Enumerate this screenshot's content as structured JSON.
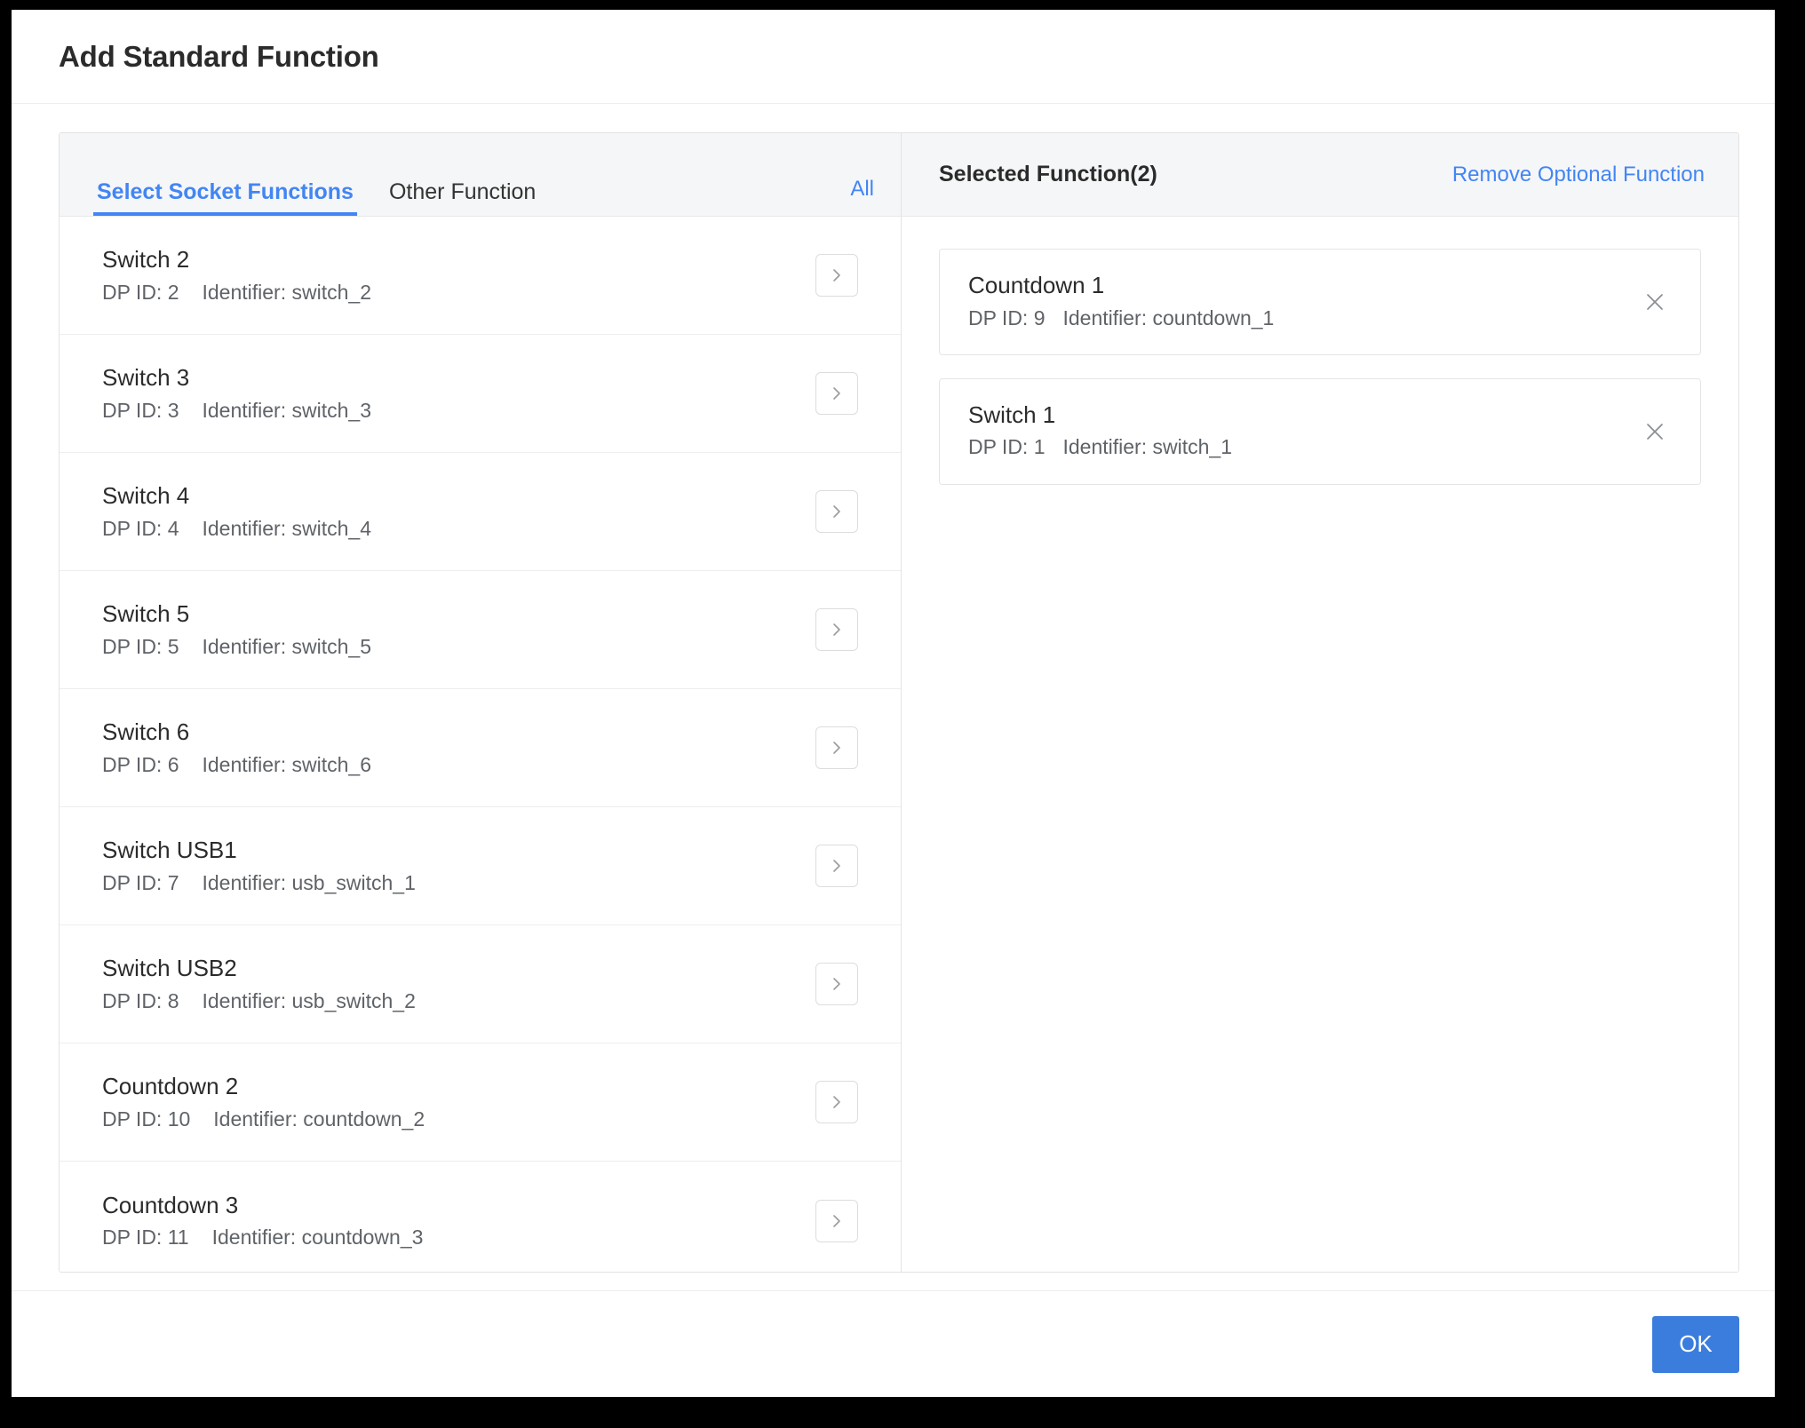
{
  "dialog": {
    "title": "Add Standard Function"
  },
  "left_panel": {
    "tabs": [
      {
        "label": "Select Socket Functions",
        "active": true
      },
      {
        "label": "Other Function",
        "active": false
      }
    ],
    "all_label": "All",
    "chevron_icon": "chevron-right-icon",
    "items": [
      {
        "name": "Switch 2",
        "dp": "DP ID: 2",
        "identifier": "Identifier: switch_2"
      },
      {
        "name": "Switch 3",
        "dp": "DP ID: 3",
        "identifier": "Identifier: switch_3"
      },
      {
        "name": "Switch 4",
        "dp": "DP ID: 4",
        "identifier": "Identifier: switch_4"
      },
      {
        "name": "Switch 5",
        "dp": "DP ID: 5",
        "identifier": "Identifier: switch_5"
      },
      {
        "name": "Switch 6",
        "dp": "DP ID: 6",
        "identifier": "Identifier: switch_6"
      },
      {
        "name": "Switch USB1",
        "dp": "DP ID: 7",
        "identifier": "Identifier: usb_switch_1"
      },
      {
        "name": "Switch USB2",
        "dp": "DP ID: 8",
        "identifier": "Identifier: usb_switch_2"
      },
      {
        "name": "Countdown 2",
        "dp": "DP ID: 10",
        "identifier": "Identifier: countdown_2"
      },
      {
        "name": "Countdown 3",
        "dp": "DP ID: 11",
        "identifier": "Identifier: countdown_3"
      }
    ]
  },
  "right_panel": {
    "title": "Selected Function(2)",
    "remove_label": "Remove Optional Function",
    "close_icon": "close-icon",
    "selected": [
      {
        "name": "Countdown 1",
        "dp": "DP ID: 9",
        "identifier": "Identifier: countdown_1"
      },
      {
        "name": "Switch 1",
        "dp": "DP ID: 1",
        "identifier": "Identifier: switch_1"
      }
    ]
  },
  "footer": {
    "ok_label": "OK"
  },
  "colors": {
    "accent": "#4285f4",
    "primary_button": "#3b7ddd",
    "text": "#2b2b2b",
    "muted_text": "#5f6368",
    "border": "#e2e3e5",
    "panel_head_bg": "#f5f6f7"
  }
}
